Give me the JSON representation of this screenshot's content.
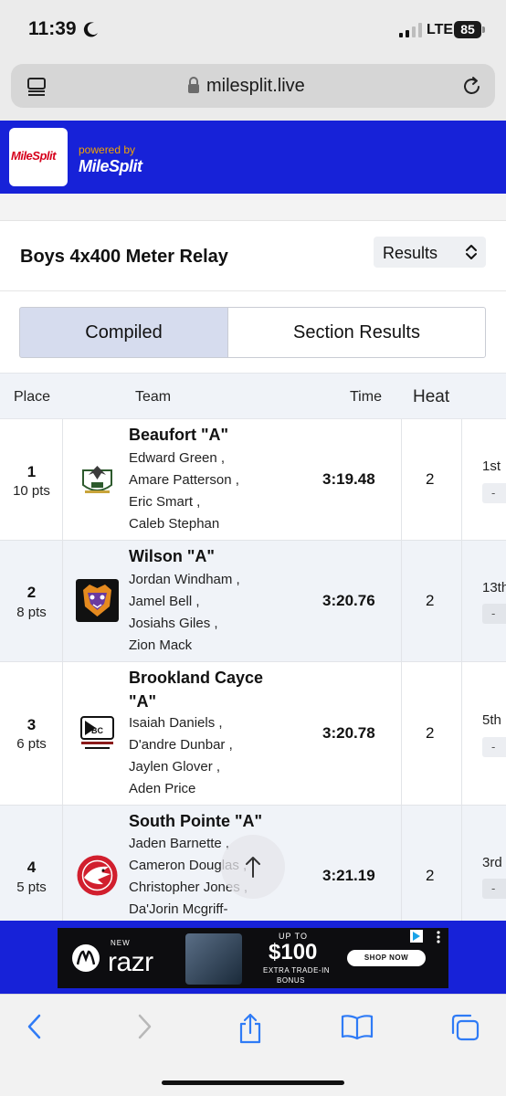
{
  "status": {
    "time": "11:39",
    "network": "LTE",
    "battery": "85"
  },
  "browser": {
    "url": "milesplit.live"
  },
  "header": {
    "logo_text": "MileSplit",
    "powered_by": "powered by",
    "powered_logo": "MileSplit"
  },
  "event": {
    "title": "Boys 4x400 Meter Relay",
    "view_select": "Results"
  },
  "tabs": [
    {
      "label": "Compiled",
      "active": true
    },
    {
      "label": "Section Results",
      "active": false
    }
  ],
  "table": {
    "columns": {
      "place": "Place",
      "team": "Team",
      "time": "Time",
      "heat": "Heat"
    },
    "rows": [
      {
        "place": "1",
        "points": "10 pts",
        "team": "Beaufort \"A\"",
        "athletes": [
          "Edward Green ,",
          "Amare Patterson ,",
          "Eric Smart ,",
          "Caleb Stephan"
        ],
        "time": "3:19.48",
        "heat": "2",
        "section_place": "1st",
        "section_extra": "-"
      },
      {
        "place": "2",
        "points": "8 pts",
        "team": "Wilson \"A\"",
        "athletes": [
          "Jordan Windham ,",
          "Jamel Bell ,",
          "Josiahs Giles ,",
          "Zion Mack"
        ],
        "time": "3:20.76",
        "heat": "2",
        "section_place": "13th",
        "section_extra": "-"
      },
      {
        "place": "3",
        "points": "6 pts",
        "team_line1": "Brookland Cayce",
        "team_line2": "\"A\"",
        "athletes": [
          "Isaiah Daniels ,",
          "D'andre Dunbar ,",
          "Jaylen Glover ,",
          "Aden Price"
        ],
        "time": "3:20.78",
        "heat": "2",
        "section_place": "5th",
        "section_extra": "-"
      },
      {
        "place": "4",
        "points": "5 pts",
        "team": "South Pointe \"A\"",
        "athletes": [
          "Jaden Barnette ,",
          "Cameron Douglas ,",
          "Christopher Jones ,",
          "Da'Jorin Mcgriff-"
        ],
        "time": "3:21.19",
        "heat": "2",
        "section_place": "3rd",
        "section_extra": "-"
      }
    ]
  },
  "ad": {
    "new": "NEW",
    "brand": "razr",
    "up_to": "UP TO",
    "price": "$100",
    "extra": "EXTRA TRADE-IN",
    "bonus": "BONUS",
    "cta": "SHOP NOW"
  },
  "colors": {
    "brand_blue": "#1722d8",
    "ios_blue": "#2f7bf6",
    "tab_active": "#d6dcee"
  },
  "icons": [
    "moon-icon",
    "signal-icon",
    "reader-icon",
    "lock-icon",
    "reload-icon",
    "select-arrows-icon",
    "arrow-up-icon",
    "back-icon",
    "forward-icon",
    "share-icon",
    "bookmarks-icon",
    "tabs-icon"
  ]
}
